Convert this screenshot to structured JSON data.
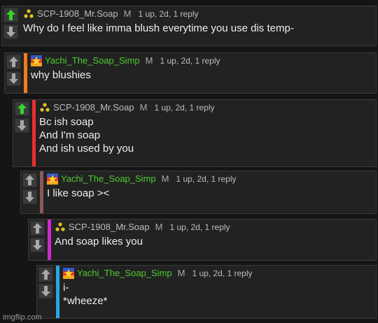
{
  "colors": {
    "upvoted_arrow": "#35d62b",
    "arrow": "#a8a8a8",
    "orange_bar": "#f07c1c",
    "red_bar": "#e8302c",
    "brown_bar": "#8a5a57",
    "purple_bar": "#cb2bce",
    "blue_bar": "#25a8e4"
  },
  "comments": [
    {
      "username": "SCP-1908_Mr.Soap",
      "avatar": "biohazard-icon",
      "badge": "M",
      "stats": "1 up, 2d, 1 reply",
      "lines": [
        "Why do I feel like imma blush everytime you use dis temp-"
      ],
      "upvoted": true
    },
    {
      "username": "Yachi_The_Soap_Simp",
      "avatar": "star-flag-icon",
      "badge": "M",
      "stats": "1 up, 2d, 1 reply",
      "lines": [
        "why blushies"
      ],
      "upvoted": false
    },
    {
      "username": "SCP-1908_Mr.Soap",
      "avatar": "biohazard-icon",
      "badge": "M",
      "stats": "1 up, 2d, 1 reply",
      "lines": [
        "Bc ish soap",
        "And I'm soap",
        "And ish used by you"
      ],
      "upvoted": true
    },
    {
      "username": "Yachi_The_Soap_Simp",
      "avatar": "star-flag-icon",
      "badge": "M",
      "stats": "1 up, 2d, 1 reply",
      "lines": [
        "I like soap ><"
      ],
      "upvoted": false
    },
    {
      "username": "SCP-1908_Mr.Soap",
      "avatar": "biohazard-icon",
      "badge": "M",
      "stats": "1 up, 2d, 1 reply",
      "lines": [
        "And soap likes you"
      ],
      "upvoted": false
    },
    {
      "username": "Yachi_The_Soap_Simp",
      "avatar": "star-flag-icon",
      "badge": "M",
      "stats": "1 up, 2d, 1 reply",
      "lines": [
        "i-",
        "*wheeze*"
      ],
      "upvoted": false
    }
  ],
  "footer": "imgflip.com"
}
